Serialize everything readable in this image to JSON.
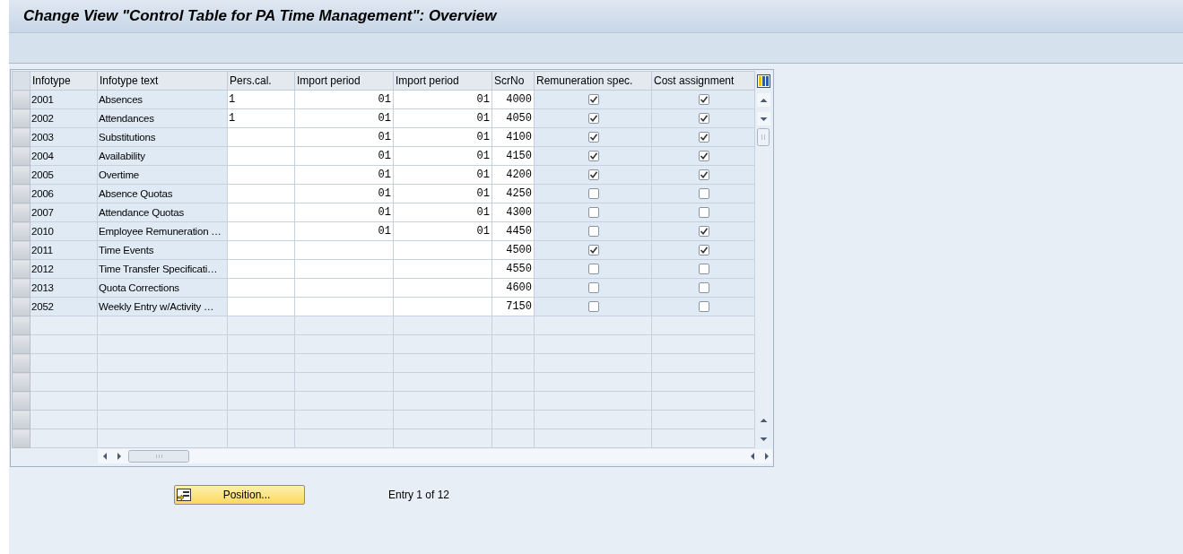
{
  "window": {
    "title": "Change View \"Control Table for PA Time Management\": Overview"
  },
  "table": {
    "columns": [
      "Infotype",
      "Infotype text",
      "Pers.cal.",
      "Import period",
      "Import period",
      "ScrNo",
      "Remuneration spec.",
      "Cost assignment"
    ],
    "rows": [
      {
        "infotype": "2001",
        "text": "Absences",
        "pers_cal": "1",
        "import_period_1": "01",
        "import_period_2": "01",
        "scr_no": "4000",
        "remuneration_spec": true,
        "cost_assignment": true
      },
      {
        "infotype": "2002",
        "text": "Attendances",
        "pers_cal": "1",
        "import_period_1": "01",
        "import_period_2": "01",
        "scr_no": "4050",
        "remuneration_spec": true,
        "cost_assignment": true
      },
      {
        "infotype": "2003",
        "text": "Substitutions",
        "import_period_1": "01",
        "import_period_2": "01",
        "scr_no": "4100",
        "remuneration_spec": true,
        "cost_assignment": true
      },
      {
        "infotype": "2004",
        "text": "Availability",
        "import_period_1": "01",
        "import_period_2": "01",
        "scr_no": "4150",
        "remuneration_spec": true,
        "cost_assignment": true
      },
      {
        "infotype": "2005",
        "text": "Overtime",
        "import_period_1": "01",
        "import_period_2": "01",
        "scr_no": "4200",
        "remuneration_spec": true,
        "cost_assignment": true
      },
      {
        "infotype": "2006",
        "text": "Absence Quotas",
        "import_period_1": "01",
        "import_period_2": "01",
        "scr_no": "4250",
        "remuneration_spec": false,
        "cost_assignment": false
      },
      {
        "infotype": "2007",
        "text": "Attendance Quotas",
        "import_period_1": "01",
        "import_period_2": "01",
        "scr_no": "4300",
        "remuneration_spec": false,
        "cost_assignment": false
      },
      {
        "infotype": "2010",
        "text": "Employee Remuneration …",
        "import_period_1": "01",
        "import_period_2": "01",
        "scr_no": "4450",
        "remuneration_spec": false,
        "cost_assignment": true
      },
      {
        "infotype": "2011",
        "text": "Time Events",
        "scr_no": "4500",
        "remuneration_spec": true,
        "cost_assignment": true
      },
      {
        "infotype": "2012",
        "text": "Time Transfer Specificati…",
        "scr_no": "4550",
        "remuneration_spec": false,
        "cost_assignment": false
      },
      {
        "infotype": "2013",
        "text": "Quota Corrections",
        "scr_no": "4600",
        "remuneration_spec": false,
        "cost_assignment": false
      },
      {
        "infotype": "2052",
        "text": "Weekly Entry w/Activity …",
        "scr_no": "7150",
        "remuneration_spec": false,
        "cost_assignment": false
      }
    ]
  },
  "position_button": {
    "label": "Position..."
  },
  "entry_info": "Entry 1 of 12"
}
